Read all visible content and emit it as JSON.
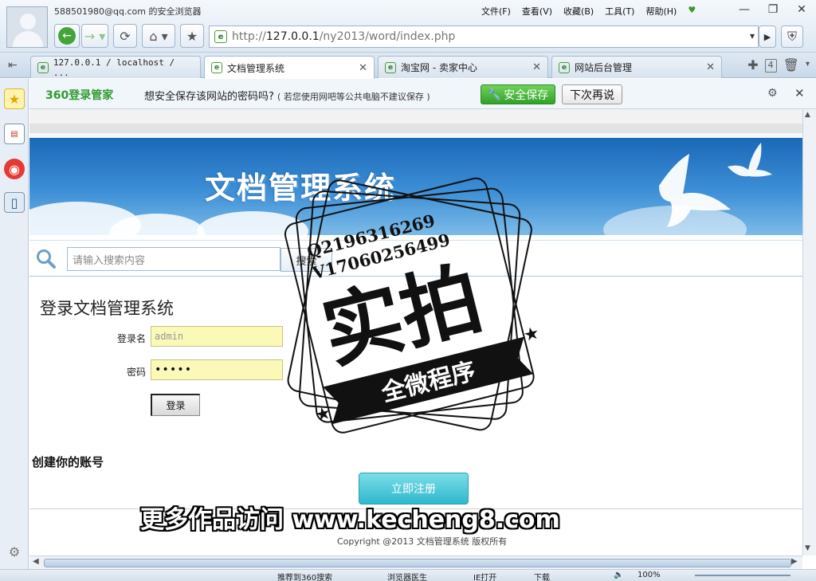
{
  "browser": {
    "user_text": "588501980@qq.com 的安全浏览器",
    "menu": [
      "文件(F)",
      "查看(V)",
      "收藏(B)",
      "工具(T)",
      "帮助(H)"
    ],
    "url_prefix": "http://",
    "url_host": "127.0.0.1",
    "url_path": "/ny2013/word/index.php",
    "tabs": [
      {
        "label": "127.0.0.1 / localhost / ..."
      },
      {
        "label": "文档管理系统"
      },
      {
        "label": "淘宝网 - 卖家中心"
      },
      {
        "label": "网站后台管理"
      }
    ],
    "tab_count": "4"
  },
  "password_bar": {
    "logo": "360登录管家",
    "question": "想安全保存该网站的密码吗?",
    "note": "( 若您使用网吧等公共电脑不建议保存 )",
    "save_label": "安全保存",
    "later_label": "下次再说"
  },
  "page": {
    "banner_title": "文档管理系统",
    "search": {
      "placeholder": "请输入搜索内容",
      "button": "搜索"
    },
    "login": {
      "title": "登录文档管理系统",
      "username_label": "登录名",
      "username_value": "admin",
      "password_label": "密码",
      "password_value": "•••••",
      "submit": "登录"
    },
    "create_account": "创建你的账号",
    "register_button": "立即注册",
    "copyright": "Copyright @2013 文档管理系统 版权所有"
  },
  "watermark": {
    "qq": "Q2196316269",
    "v": "V17060256499",
    "big": "实拍",
    "ribbon": "全微程序",
    "bottom": "更多作品访问 www.kecheng8.com"
  },
  "statusbar": {
    "items": [
      "推荐到360搜索",
      "浏览器医生",
      "IE打开",
      "下载",
      "100%"
    ]
  },
  "colors": {
    "banner": "#2b7cc9",
    "save_green": "#32a12a",
    "register_cyan": "#2fb8cc",
    "field_yellow": "#fbf9b7"
  }
}
